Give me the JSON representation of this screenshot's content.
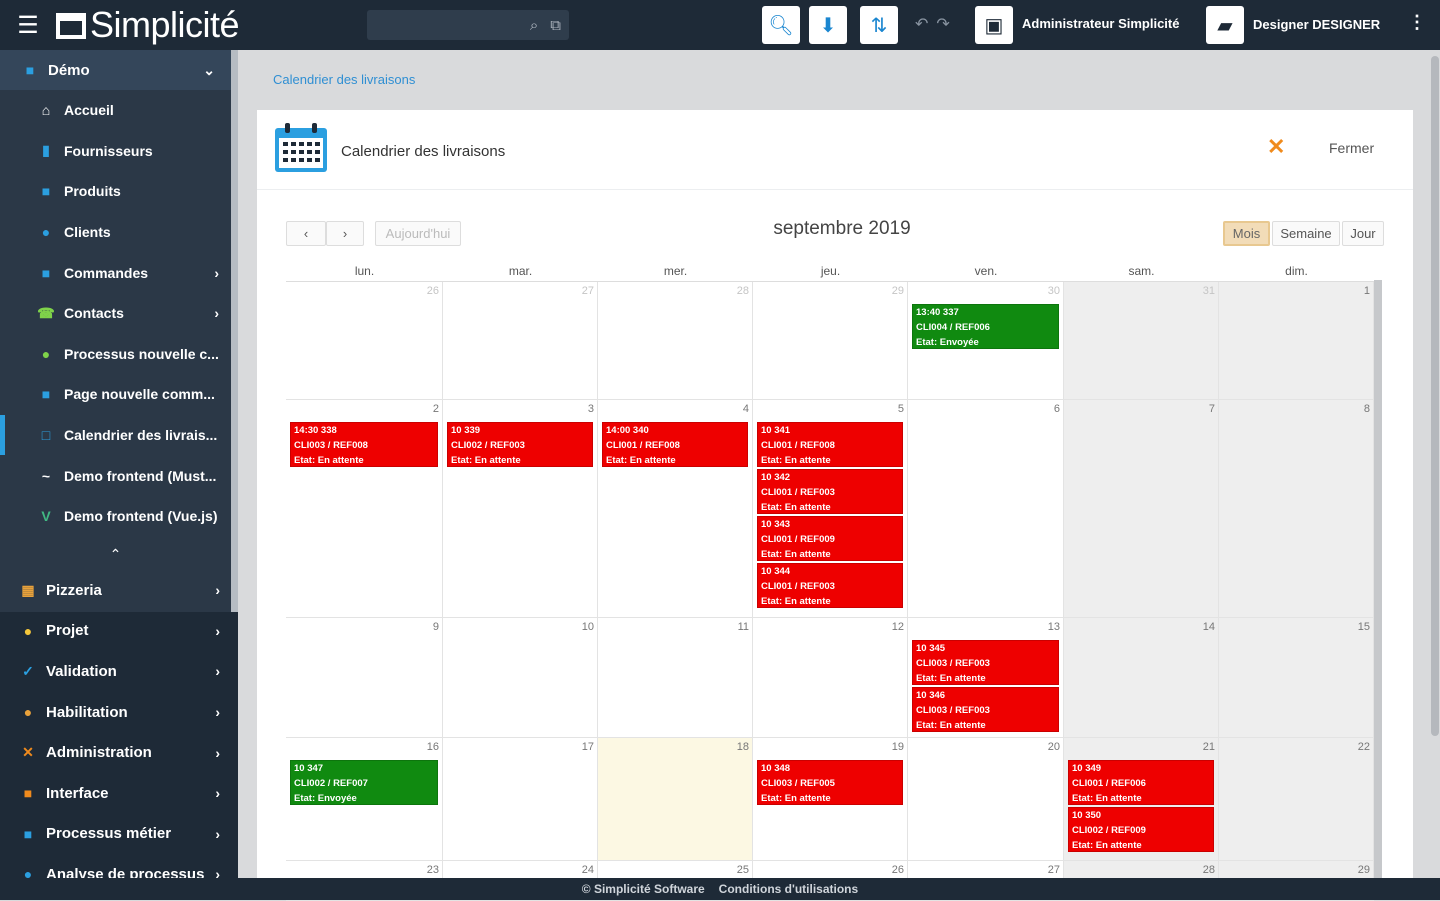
{
  "app": {
    "logo_text": "Simplicité",
    "user_label": "Administrateur Simplicité",
    "designer_label": "Designer DESIGNER",
    "more": "⋮"
  },
  "sidebar": {
    "demo_group": "Démo",
    "demo_items": [
      {
        "label": "Accueil",
        "icon": "home-icon",
        "glyph": "⌂",
        "color": "#ffffff",
        "has_chevron": false
      },
      {
        "label": "Fournisseurs",
        "icon": "supplier-icon",
        "glyph": "▮",
        "color": "#2b9fe0",
        "has_chevron": false
      },
      {
        "label": "Produits",
        "icon": "product-icon",
        "glyph": "■",
        "color": "#2b9fe0",
        "has_chevron": false
      },
      {
        "label": "Clients",
        "icon": "user-icon",
        "glyph": "●",
        "color": "#2b9fe0",
        "has_chevron": false
      },
      {
        "label": "Commandes",
        "icon": "order-icon",
        "glyph": "■",
        "color": "#2b9fe0",
        "has_chevron": true
      },
      {
        "label": "Contacts",
        "icon": "contact-icon",
        "glyph": "☎",
        "color": "#7fd34a",
        "has_chevron": true
      },
      {
        "label": "Processus nouvelle c...",
        "icon": "process-icon",
        "glyph": "●",
        "color": "#7fd34a",
        "has_chevron": false
      },
      {
        "label": "Page nouvelle comm...",
        "icon": "page-icon",
        "glyph": "■",
        "color": "#2b9fe0",
        "has_chevron": false
      },
      {
        "label": "Calendrier des livrais...",
        "icon": "calendar-icon",
        "glyph": "□",
        "color": "#2b9fe0",
        "has_chevron": false
      },
      {
        "label": "Demo frontend (Must...",
        "icon": "mustache-icon",
        "glyph": "~",
        "color": "#ffffff",
        "has_chevron": false
      },
      {
        "label": "Demo frontend (Vue.js)",
        "icon": "vue-icon",
        "glyph": "V",
        "color": "#41b883",
        "has_chevron": false
      }
    ],
    "groups": [
      {
        "label": "Pizzeria",
        "icon": "pizzeria-icon",
        "glyph": "▦",
        "color": "#e9a23b"
      },
      {
        "label": "Projet",
        "icon": "project-icon",
        "glyph": "●",
        "color": "#f5c73b"
      },
      {
        "label": "Validation",
        "icon": "validation-icon",
        "glyph": "✓",
        "color": "#2b9fe0"
      },
      {
        "label": "Habilitation",
        "icon": "habilitation-icon",
        "glyph": "●",
        "color": "#e9a23b"
      },
      {
        "label": "Administration",
        "icon": "admin-icon",
        "glyph": "✕",
        "color": "#f08b1d"
      },
      {
        "label": "Interface",
        "icon": "interface-icon",
        "glyph": "■",
        "color": "#f08b1d"
      },
      {
        "label": "Processus métier",
        "icon": "business-process-icon",
        "glyph": "■",
        "color": "#2b9fe0"
      },
      {
        "label": "Analyse de processus",
        "icon": "process-analysis-icon",
        "glyph": "●",
        "color": "#2b9fe0"
      }
    ]
  },
  "breadcrumb": "Calendrier des livraisons",
  "card": {
    "title": "Calendrier des livraisons",
    "close_label": "Fermer"
  },
  "calendar": {
    "today_label": "Aujourd'hui",
    "title": "septembre 2019",
    "views": [
      "Mois",
      "Semaine",
      "Jour"
    ],
    "active_view": "Mois",
    "days_of_week": [
      "lun.",
      "mar.",
      "mer.",
      "jeu.",
      "ven.",
      "sam.",
      "dim."
    ],
    "weeks": [
      [
        26,
        27,
        28,
        29,
        30,
        31,
        1
      ],
      [
        2,
        3,
        4,
        5,
        6,
        7,
        8
      ],
      [
        9,
        10,
        11,
        12,
        13,
        14,
        15
      ],
      [
        16,
        17,
        18,
        19,
        20,
        21,
        22
      ],
      [
        23,
        24,
        25,
        26,
        27,
        28,
        29
      ]
    ],
    "today_cell": [
      3,
      2
    ],
    "events": [
      {
        "week": 0,
        "day": 4,
        "slot": 0,
        "color": "green",
        "lines": [
          "13:40 337",
          "CLI004 / REF006",
          "Etat: Envoyée"
        ]
      },
      {
        "week": 1,
        "day": 0,
        "slot": 0,
        "color": "red",
        "lines": [
          "14:30 338",
          "CLI003 / REF008",
          "Etat: En attente"
        ]
      },
      {
        "week": 1,
        "day": 1,
        "slot": 0,
        "color": "red",
        "lines": [
          "10 339",
          "CLI002 / REF003",
          "Etat: En attente"
        ]
      },
      {
        "week": 1,
        "day": 2,
        "slot": 0,
        "color": "red",
        "lines": [
          "14:00 340",
          "CLI001 / REF008",
          "Etat: En attente"
        ]
      },
      {
        "week": 1,
        "day": 3,
        "slot": 0,
        "color": "red",
        "lines": [
          "10 341",
          "CLI001 / REF008",
          "Etat: En attente"
        ]
      },
      {
        "week": 1,
        "day": 3,
        "slot": 1,
        "color": "red",
        "lines": [
          "10 342",
          "CLI001 / REF003",
          "Etat: En attente"
        ]
      },
      {
        "week": 1,
        "day": 3,
        "slot": 2,
        "color": "red",
        "lines": [
          "10 343",
          "CLI001 / REF009",
          "Etat: En attente"
        ]
      },
      {
        "week": 1,
        "day": 3,
        "slot": 3,
        "color": "red",
        "lines": [
          "10 344",
          "CLI001 / REF003",
          "Etat: En attente"
        ]
      },
      {
        "week": 2,
        "day": 4,
        "slot": 0,
        "color": "red",
        "lines": [
          "10 345",
          "CLI003 / REF003",
          "Etat: En attente"
        ]
      },
      {
        "week": 2,
        "day": 4,
        "slot": 1,
        "color": "red",
        "lines": [
          "10 346",
          "CLI003 / REF003",
          "Etat: En attente"
        ]
      },
      {
        "week": 3,
        "day": 0,
        "slot": 0,
        "color": "green",
        "lines": [
          "10 347",
          "CLI002 / REF007",
          "Etat: Envoyée"
        ]
      },
      {
        "week": 3,
        "day": 3,
        "slot": 0,
        "color": "red",
        "lines": [
          "10 348",
          "CLI003 / REF005",
          "Etat: En attente"
        ]
      },
      {
        "week": 3,
        "day": 5,
        "slot": 0,
        "color": "red",
        "lines": [
          "10 349",
          "CLI001 / REF006",
          "Etat: En attente"
        ]
      },
      {
        "week": 3,
        "day": 5,
        "slot": 1,
        "color": "red",
        "lines": [
          "10 350",
          "CLI002 / REF009",
          "Etat: En attente"
        ]
      }
    ]
  },
  "footer": {
    "copyright": "© Simplicité Software",
    "terms": "Conditions d'utilisations"
  }
}
